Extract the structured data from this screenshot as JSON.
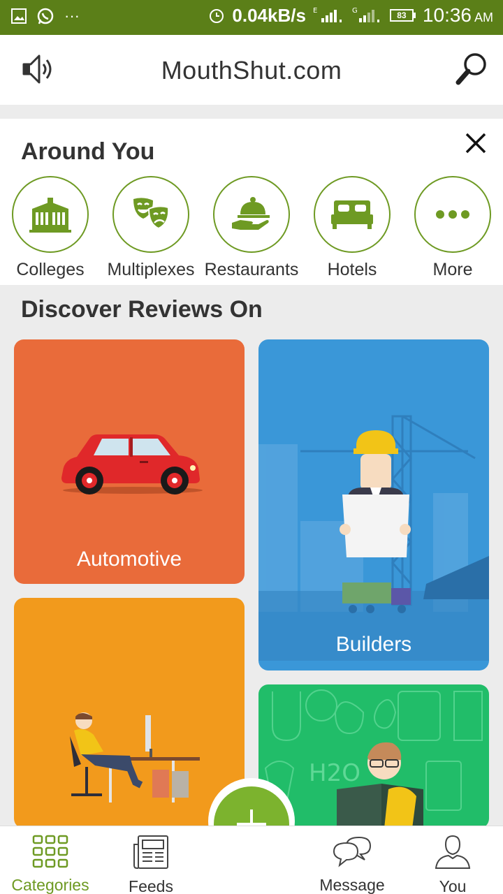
{
  "status_bar": {
    "net_speed": "0.04kB/s",
    "battery": "83",
    "time": "10:36",
    "ampm": "AM",
    "overflow": "···"
  },
  "header": {
    "title": "MouthShut.com"
  },
  "around_you": {
    "title": "Around You",
    "items": [
      {
        "label": "Colleges",
        "icon": "college-building-icon"
      },
      {
        "label": "Multiplexes",
        "icon": "theatre-masks-icon"
      },
      {
        "label": "Restaurants",
        "icon": "serving-cloche-icon"
      },
      {
        "label": "Hotels",
        "icon": "bed-icon"
      },
      {
        "label": "More",
        "icon": "more-dots-icon"
      }
    ]
  },
  "discover": {
    "title": "Discover Reviews On",
    "tiles": [
      {
        "label": "Automotive",
        "color": "#e96b3a"
      },
      {
        "label": "Builders",
        "color": "#3a97d8"
      },
      {
        "label": "",
        "color": "#f29a1c"
      },
      {
        "label": "",
        "color": "#21bd69"
      }
    ]
  },
  "bottom_nav": {
    "items": [
      {
        "label": "Categories",
        "icon": "grid-icon",
        "active": true
      },
      {
        "label": "Feeds",
        "icon": "newspaper-icon",
        "active": false
      },
      {
        "label": "Message",
        "icon": "chat-bubbles-icon",
        "active": false
      },
      {
        "label": "You",
        "icon": "user-icon",
        "active": false
      }
    ],
    "fab_symbol": "+"
  },
  "colors": {
    "brand_green": "#6e9a23",
    "status_green": "#5b7f18",
    "fab_green": "#7cb32e"
  }
}
